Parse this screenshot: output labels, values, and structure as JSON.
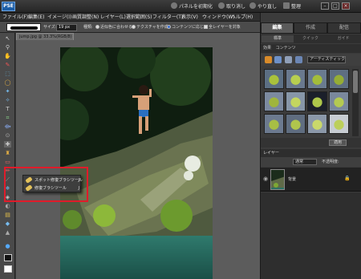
{
  "app": {
    "logo": "PSE"
  },
  "titlebar": {
    "undo_history_label": "パネルを初期化",
    "undo_label": "取り消し",
    "redo_label": "やり直し",
    "organizer_label": "整理"
  },
  "menus": [
    "ファイル(F)",
    "編集(E)",
    "イメージ(I)",
    "画質調整(N)",
    "レイヤー(L)",
    "選択範囲(S)",
    "フィルター(T)",
    "表示(V)",
    "ウィンドウ(W)",
    "ヘルプ(H)"
  ],
  "options": {
    "size_label": "サイズ:",
    "size_value": "19 px",
    "type_label": "種類:",
    "radio_proximity": "近似色に合わせる",
    "radio_texture": "テクスチャを作成",
    "radio_content_aware": "コンテンツに応じる",
    "sample_all_layers": "全レイヤーを対象"
  },
  "document": {
    "tab_title": "jump.jpg @ 33.3%(RGB/8)"
  },
  "panel": {
    "mode_tabs": [
      "編集",
      "作成",
      "配信"
    ],
    "sub_tabs": [
      "標準",
      "クイック",
      "ガイド"
    ],
    "bin_header_tabs": [
      "効果",
      "コンテンツ"
    ],
    "bin_select": "アーティスティック",
    "apply_button": "適用",
    "layers_header": "レイヤー",
    "blend_mode": "通常",
    "opacity_label": "不透明度:",
    "layer_name": "背景"
  },
  "flyout": {
    "items": [
      "スポット修復ブラシツール",
      "修復ブラシツール"
    ],
    "shortcut": "J"
  },
  "colors": {
    "highlight_box": "#e01b2a",
    "thumb_green": "#8dbb2a"
  }
}
